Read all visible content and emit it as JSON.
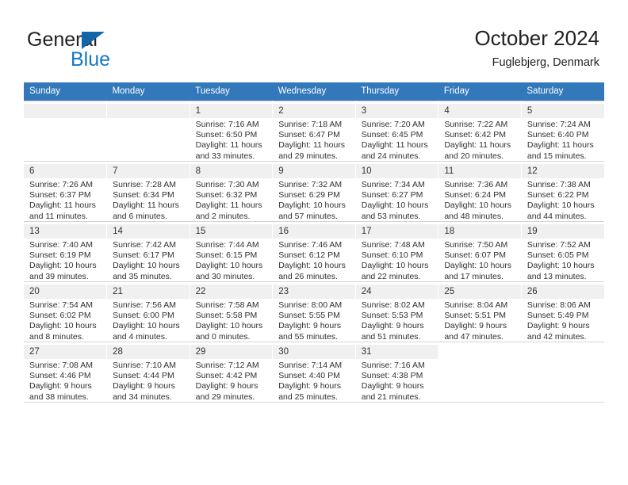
{
  "brand": {
    "name_top": "General",
    "name_bottom": "Blue",
    "triangle_color": "#1464aa",
    "blue_color": "#1478c8"
  },
  "header": {
    "title": "October 2024",
    "subtitle": "Fuglebjerg, Denmark"
  },
  "theme": {
    "header_row_bg": "#3378bb",
    "header_row_text": "#ffffff",
    "daynum_bg": "#f0f0f0",
    "grid_line": "#d5d5d5"
  },
  "weekdays": [
    "Sunday",
    "Monday",
    "Tuesday",
    "Wednesday",
    "Thursday",
    "Friday",
    "Saturday"
  ],
  "labels": {
    "sunrise_prefix": "Sunrise:",
    "sunset_prefix": "Sunset:",
    "daylight_prefix": "Daylight:"
  },
  "weeks": [
    [
      {
        "day": "",
        "empty": true
      },
      {
        "day": "",
        "empty": true
      },
      {
        "day": "1",
        "sunrise": "Sunrise: 7:16 AM",
        "sunset": "Sunset: 6:50 PM",
        "daylight1": "Daylight: 11 hours",
        "daylight2": "and 33 minutes."
      },
      {
        "day": "2",
        "sunrise": "Sunrise: 7:18 AM",
        "sunset": "Sunset: 6:47 PM",
        "daylight1": "Daylight: 11 hours",
        "daylight2": "and 29 minutes."
      },
      {
        "day": "3",
        "sunrise": "Sunrise: 7:20 AM",
        "sunset": "Sunset: 6:45 PM",
        "daylight1": "Daylight: 11 hours",
        "daylight2": "and 24 minutes."
      },
      {
        "day": "4",
        "sunrise": "Sunrise: 7:22 AM",
        "sunset": "Sunset: 6:42 PM",
        "daylight1": "Daylight: 11 hours",
        "daylight2": "and 20 minutes."
      },
      {
        "day": "5",
        "sunrise": "Sunrise: 7:24 AM",
        "sunset": "Sunset: 6:40 PM",
        "daylight1": "Daylight: 11 hours",
        "daylight2": "and 15 minutes."
      }
    ],
    [
      {
        "day": "6",
        "sunrise": "Sunrise: 7:26 AM",
        "sunset": "Sunset: 6:37 PM",
        "daylight1": "Daylight: 11 hours",
        "daylight2": "and 11 minutes."
      },
      {
        "day": "7",
        "sunrise": "Sunrise: 7:28 AM",
        "sunset": "Sunset: 6:34 PM",
        "daylight1": "Daylight: 11 hours",
        "daylight2": "and 6 minutes."
      },
      {
        "day": "8",
        "sunrise": "Sunrise: 7:30 AM",
        "sunset": "Sunset: 6:32 PM",
        "daylight1": "Daylight: 11 hours",
        "daylight2": "and 2 minutes."
      },
      {
        "day": "9",
        "sunrise": "Sunrise: 7:32 AM",
        "sunset": "Sunset: 6:29 PM",
        "daylight1": "Daylight: 10 hours",
        "daylight2": "and 57 minutes."
      },
      {
        "day": "10",
        "sunrise": "Sunrise: 7:34 AM",
        "sunset": "Sunset: 6:27 PM",
        "daylight1": "Daylight: 10 hours",
        "daylight2": "and 53 minutes."
      },
      {
        "day": "11",
        "sunrise": "Sunrise: 7:36 AM",
        "sunset": "Sunset: 6:24 PM",
        "daylight1": "Daylight: 10 hours",
        "daylight2": "and 48 minutes."
      },
      {
        "day": "12",
        "sunrise": "Sunrise: 7:38 AM",
        "sunset": "Sunset: 6:22 PM",
        "daylight1": "Daylight: 10 hours",
        "daylight2": "and 44 minutes."
      }
    ],
    [
      {
        "day": "13",
        "sunrise": "Sunrise: 7:40 AM",
        "sunset": "Sunset: 6:19 PM",
        "daylight1": "Daylight: 10 hours",
        "daylight2": "and 39 minutes."
      },
      {
        "day": "14",
        "sunrise": "Sunrise: 7:42 AM",
        "sunset": "Sunset: 6:17 PM",
        "daylight1": "Daylight: 10 hours",
        "daylight2": "and 35 minutes."
      },
      {
        "day": "15",
        "sunrise": "Sunrise: 7:44 AM",
        "sunset": "Sunset: 6:15 PM",
        "daylight1": "Daylight: 10 hours",
        "daylight2": "and 30 minutes."
      },
      {
        "day": "16",
        "sunrise": "Sunrise: 7:46 AM",
        "sunset": "Sunset: 6:12 PM",
        "daylight1": "Daylight: 10 hours",
        "daylight2": "and 26 minutes."
      },
      {
        "day": "17",
        "sunrise": "Sunrise: 7:48 AM",
        "sunset": "Sunset: 6:10 PM",
        "daylight1": "Daylight: 10 hours",
        "daylight2": "and 22 minutes."
      },
      {
        "day": "18",
        "sunrise": "Sunrise: 7:50 AM",
        "sunset": "Sunset: 6:07 PM",
        "daylight1": "Daylight: 10 hours",
        "daylight2": "and 17 minutes."
      },
      {
        "day": "19",
        "sunrise": "Sunrise: 7:52 AM",
        "sunset": "Sunset: 6:05 PM",
        "daylight1": "Daylight: 10 hours",
        "daylight2": "and 13 minutes."
      }
    ],
    [
      {
        "day": "20",
        "sunrise": "Sunrise: 7:54 AM",
        "sunset": "Sunset: 6:02 PM",
        "daylight1": "Daylight: 10 hours",
        "daylight2": "and 8 minutes."
      },
      {
        "day": "21",
        "sunrise": "Sunrise: 7:56 AM",
        "sunset": "Sunset: 6:00 PM",
        "daylight1": "Daylight: 10 hours",
        "daylight2": "and 4 minutes."
      },
      {
        "day": "22",
        "sunrise": "Sunrise: 7:58 AM",
        "sunset": "Sunset: 5:58 PM",
        "daylight1": "Daylight: 10 hours",
        "daylight2": "and 0 minutes."
      },
      {
        "day": "23",
        "sunrise": "Sunrise: 8:00 AM",
        "sunset": "Sunset: 5:55 PM",
        "daylight1": "Daylight: 9 hours",
        "daylight2": "and 55 minutes."
      },
      {
        "day": "24",
        "sunrise": "Sunrise: 8:02 AM",
        "sunset": "Sunset: 5:53 PM",
        "daylight1": "Daylight: 9 hours",
        "daylight2": "and 51 minutes."
      },
      {
        "day": "25",
        "sunrise": "Sunrise: 8:04 AM",
        "sunset": "Sunset: 5:51 PM",
        "daylight1": "Daylight: 9 hours",
        "daylight2": "and 47 minutes."
      },
      {
        "day": "26",
        "sunrise": "Sunrise: 8:06 AM",
        "sunset": "Sunset: 5:49 PM",
        "daylight1": "Daylight: 9 hours",
        "daylight2": "and 42 minutes."
      }
    ],
    [
      {
        "day": "27",
        "sunrise": "Sunrise: 7:08 AM",
        "sunset": "Sunset: 4:46 PM",
        "daylight1": "Daylight: 9 hours",
        "daylight2": "and 38 minutes."
      },
      {
        "day": "28",
        "sunrise": "Sunrise: 7:10 AM",
        "sunset": "Sunset: 4:44 PM",
        "daylight1": "Daylight: 9 hours",
        "daylight2": "and 34 minutes."
      },
      {
        "day": "29",
        "sunrise": "Sunrise: 7:12 AM",
        "sunset": "Sunset: 4:42 PM",
        "daylight1": "Daylight: 9 hours",
        "daylight2": "and 29 minutes."
      },
      {
        "day": "30",
        "sunrise": "Sunrise: 7:14 AM",
        "sunset": "Sunset: 4:40 PM",
        "daylight1": "Daylight: 9 hours",
        "daylight2": "and 25 minutes."
      },
      {
        "day": "31",
        "sunrise": "Sunrise: 7:16 AM",
        "sunset": "Sunset: 4:38 PM",
        "daylight1": "Daylight: 9 hours",
        "daylight2": "and 21 minutes."
      },
      {
        "day": "",
        "empty": true,
        "tail": true
      },
      {
        "day": "",
        "empty": true,
        "tail": true
      }
    ]
  ]
}
